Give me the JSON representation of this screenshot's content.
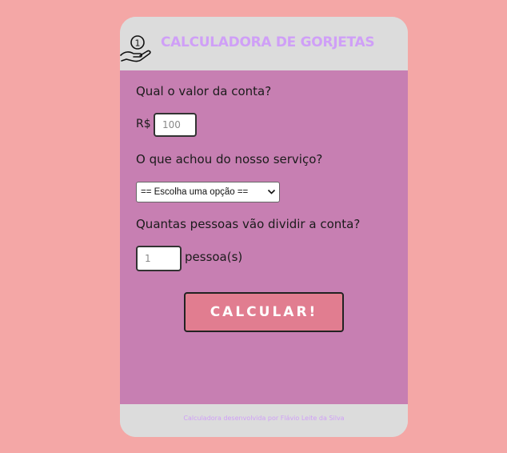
{
  "header": {
    "title": "CALCULADORA DE GORJETAS",
    "logo_icon": "hand-coin-icon",
    "logo_coin_text": "1",
    "title_color": "#cf9ff7"
  },
  "form": {
    "bill_question": "Qual o valor da conta?",
    "currency": "R$",
    "bill_placeholder": "100",
    "service_question": "O que achou do nosso serviço?",
    "service_select_value": "== Escolha uma opção ==",
    "people_question": "Quantas pessoas vão dividir a conta?",
    "people_placeholder": "1",
    "people_unit": "pessoa(s)",
    "calculate_label": "CALCULAR!"
  },
  "footer": {
    "credit": "Calculadora desenvolvida por Flávio Leite da Silva"
  },
  "colors": {
    "background": "#f4a7a6",
    "panel": "#c77fb2",
    "header": "#dcdcdc",
    "button": "#e17d90"
  }
}
